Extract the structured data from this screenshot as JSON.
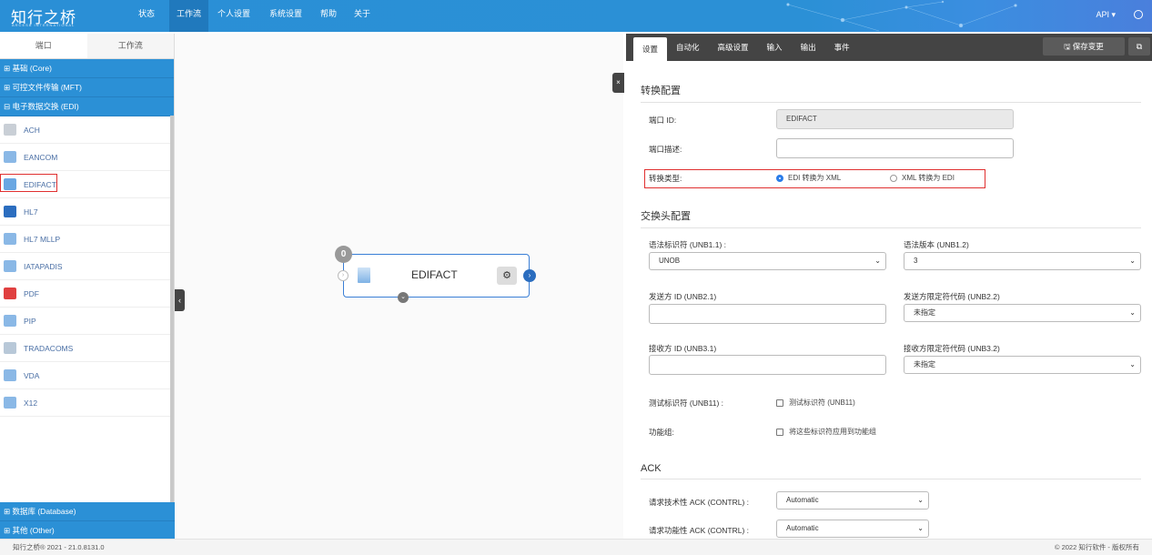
{
  "header": {
    "logo": "知行之桥",
    "logo_sub": "ARCESB INTERNATIONAL",
    "nav": [
      "状态",
      "工作流",
      "个人设置",
      "系统设置",
      "帮助",
      "关于"
    ],
    "active_nav": "工作流",
    "api": "API ▾"
  },
  "sidebar": {
    "tabs": [
      "端口",
      "工作流"
    ],
    "groups_top": [
      "⊞ 基础 (Core)",
      "⊞ 可控文件传输 (MFT)",
      "⊟ 电子数据交换 (EDI)"
    ],
    "items": [
      {
        "label": "ACH",
        "color": "#c9cfd6"
      },
      {
        "label": "EANCOM",
        "color": "#8ab8e6"
      },
      {
        "label": "EDIFACT",
        "color": "#6aa7e2"
      },
      {
        "label": "HL7",
        "color": "#2b6dbf"
      },
      {
        "label": "HL7 MLLP",
        "color": "#8ab8e6"
      },
      {
        "label": "IATAPADIS",
        "color": "#8ab8e6"
      },
      {
        "label": "PDF",
        "color": "#e04040"
      },
      {
        "label": "PIP",
        "color": "#8ab8e6"
      },
      {
        "label": "TRADACOMS",
        "color": "#b8c8d8"
      },
      {
        "label": "VDA",
        "color": "#8ab8e6"
      },
      {
        "label": "X12",
        "color": "#8ab8e6"
      }
    ],
    "groups_bottom": [
      "⊞ 数据库 (Database)",
      "⊞ 其他 (Other)"
    ]
  },
  "canvas": {
    "node_label": "EDIFACT",
    "node_badge": "0"
  },
  "panel": {
    "tabs": [
      "设置",
      "自动化",
      "高级设置",
      "输入",
      "输出",
      "事件"
    ],
    "save": "🖫 保存变更",
    "popout": "⧉",
    "sec_convert": "转换配置",
    "port_id_label": "端口 ID:",
    "port_id_value": "EDIFACT",
    "port_desc_label": "端口描述:",
    "convert_type_label": "转换类型:",
    "radio_edi_xml": "EDI 转换为 XML",
    "radio_xml_edi": "XML 转换为 EDI",
    "sec_interchange": "交换头配置",
    "syntax_id_label": "语法标识符 (UNB1.1) :",
    "syntax_id_value": "UNOB",
    "syntax_ver_label": "语法版本 (UNB1.2)",
    "syntax_ver_value": "3",
    "sender_id_label": "发送方 ID (UNB2.1)",
    "sender_q_label": "发送方限定符代码 (UNB2.2)",
    "sender_q_value": "未指定",
    "recv_id_label": "接收方 ID (UNB3.1)",
    "recv_q_label": "接收方限定符代码 (UNB3.2)",
    "recv_q_value": "未指定",
    "test_label": "测试标识符 (UNB11) :",
    "test_chk": "测试标识符 (UNB11)",
    "fg_label": "功能组:",
    "fg_chk": "将这些标识符应用到功能组",
    "sec_ack": "ACK",
    "ack_tech_label": "请求技术性 ACK (CONTRL) :",
    "ack_tech_value": "Automatic",
    "ack_func_label": "请求功能性 ACK (CONTRL) :",
    "ack_func_value": "Automatic"
  },
  "footer": {
    "left": "知行之桥® 2021 - 21.0.8131.0",
    "right": "© 2022 知行软件 - 版权所有"
  }
}
